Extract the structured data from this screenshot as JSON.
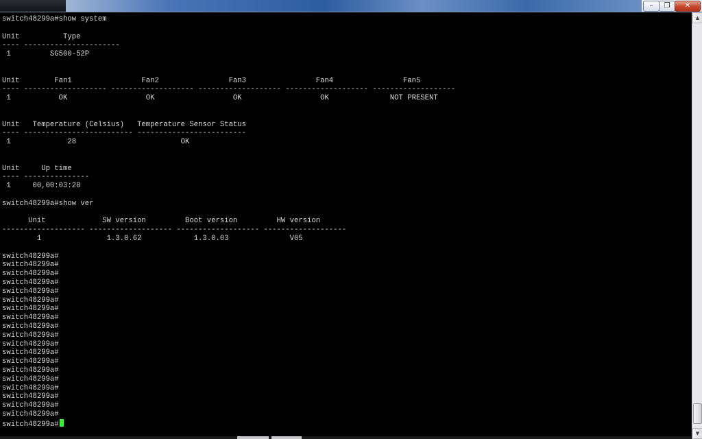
{
  "window": {
    "buttons": {
      "minimize": "–",
      "maximize": "❐",
      "close": "✕"
    }
  },
  "terminal": {
    "prompt": "switch48299a#",
    "lines": [
      "switch48299a#show system",
      "",
      "Unit          Type",
      "---- ----------------------",
      " 1         SG500-52P",
      "",
      "",
      "Unit        Fan1                Fan2                Fan3                Fan4                Fan5",
      "---- ------------------- ------------------- ------------------- ------------------- -------------------",
      " 1           OK                  OK                  OK                  OK              NOT PRESENT",
      "",
      "",
      "Unit   Temperature (Celsius)   Temperature Sensor Status",
      "---- ------------------------- -------------------------",
      " 1             28                        OK",
      "",
      "",
      "Unit     Up time",
      "---- ---------------",
      " 1     00,00:03:28",
      "",
      "switch48299a#show ver",
      "",
      "      Unit             SW version         Boot version         HW version",
      "------------------- ------------------- ------------------- -------------------",
      "        1               1.3.0.62            1.3.0.03              V05",
      "",
      "switch48299a#",
      "switch48299a#",
      "switch48299a#",
      "switch48299a#",
      "switch48299a#",
      "switch48299a#",
      "switch48299a#",
      "switch48299a#",
      "switch48299a#",
      "switch48299a#",
      "switch48299a#",
      "switch48299a#",
      "switch48299a#",
      "switch48299a#",
      "switch48299a#",
      "switch48299a#",
      "switch48299a#",
      "switch48299a#",
      "switch48299a#",
      "switch48299a#"
    ],
    "cursor_color": "#29ff29",
    "text_color": "#d8d8d8",
    "background": "#000000"
  },
  "scrollbar": {
    "up_arrow": "▲",
    "down_arrow": "▼",
    "position_fraction": 0.97
  }
}
